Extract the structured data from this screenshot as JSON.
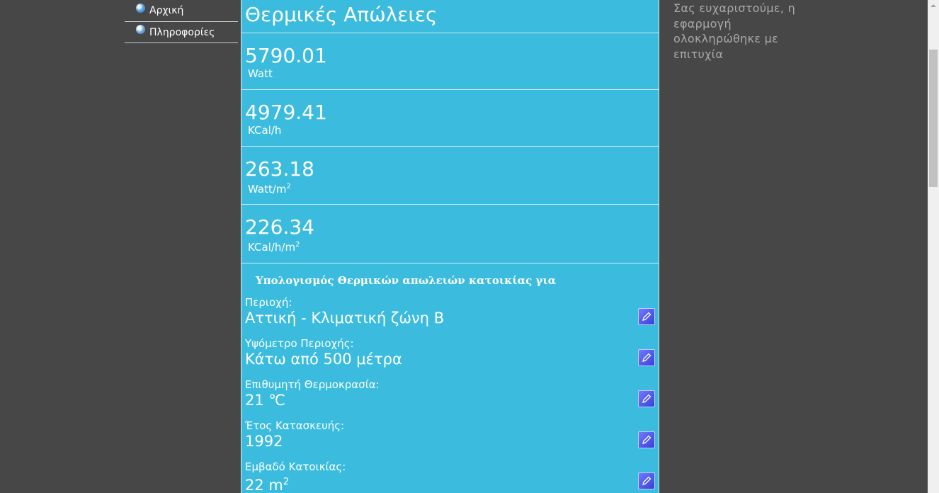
{
  "nav": {
    "items": [
      {
        "label": "Αρχική",
        "icon": "globe-icon"
      },
      {
        "label": "Πληροφορίες",
        "icon": "info-icon"
      }
    ]
  },
  "panel": {
    "title": "Θερμικές Απώλειες",
    "results": [
      {
        "value": "5790.01",
        "unit": "Watt",
        "unit_sup": ""
      },
      {
        "value": "4979.41",
        "unit": "KCal/h",
        "unit_sup": ""
      },
      {
        "value": "263.18",
        "unit": "Watt/m",
        "unit_sup": "2"
      },
      {
        "value": "226.34",
        "unit": "KCal/h/m",
        "unit_sup": "2"
      }
    ],
    "calc_heading": "Υπολογισμός Θερμικών απωλειών κατοικίας για",
    "params": [
      {
        "label": "Περιοχή:",
        "value": "Αττική - Κλιματική ζώνη Β",
        "value_sup": ""
      },
      {
        "label": "Υψόμετρο Περιοχής:",
        "value": "Κάτω από 500 μέτρα",
        "value_sup": ""
      },
      {
        "label": "Επιθυμητή Θερμοκρασία:",
        "value": "21 ℃",
        "value_sup": ""
      },
      {
        "label": "Έτος Κατασκευής:",
        "value": "1992",
        "value_sup": ""
      },
      {
        "label": "Εμβαδό Κατοικίας:",
        "value": "22 m",
        "value_sup": "2"
      }
    ]
  },
  "message": {
    "text": "Σας ευχαριστούμε, η εφαρμογή ολοκληρώθηκε με επιτυχία"
  },
  "colors": {
    "background": "#474747",
    "panel": "#3bbcde",
    "edit_button": "#4a4ee6",
    "message_text": "#a9a9a9"
  }
}
